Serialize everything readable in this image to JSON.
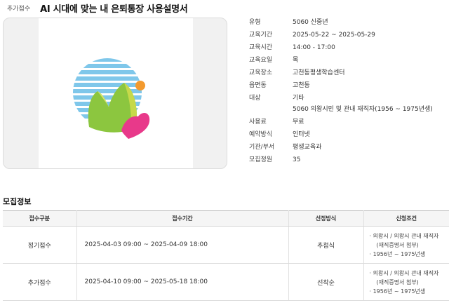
{
  "header": {
    "badge": "추가접수",
    "title": "AI 시대에 맞는 내 은퇴통장 사용설명서"
  },
  "info": [
    {
      "label": "유형",
      "value": "5060 신중년"
    },
    {
      "label": "교육기간",
      "value": "2025-05-22 ~ 2025-05-29"
    },
    {
      "label": "교육시간",
      "value": "14:00 - 17:00"
    },
    {
      "label": "교육요일",
      "value": "목"
    },
    {
      "label": "교육장소",
      "value": "고천동평생학습센터"
    },
    {
      "label": "읍면동",
      "value": "고천동"
    },
    {
      "label": "대상",
      "value": "기타",
      "sub": "5060 의왕시민 및 관내 재직자(1956 ~ 1975년생)"
    },
    {
      "label": "사용료",
      "value": "무료"
    },
    {
      "label": "예약방식",
      "value": "인터넷"
    },
    {
      "label": "기관/부서",
      "value": "평생교육과"
    },
    {
      "label": "모집정원",
      "value": "35"
    }
  ],
  "recruit": {
    "title": "모집정보",
    "columns": [
      "접수구분",
      "접수기간",
      "선정방식",
      "신청조건"
    ],
    "rows": [
      {
        "type": "정기접수",
        "period": "2025-04-03 09:00 ~ 2025-04-09 18:00",
        "method": "추첨식",
        "cond1": "의왕시 / 의왕시 관내 재직자",
        "cond1_sub": "(재직증명서 첨부)",
        "cond2": "1956년 ~ 1975년생"
      },
      {
        "type": "추가접수",
        "period": "2025-04-10 09:00 ~ 2025-05-18 18:00",
        "method": "선착순",
        "cond1": "의왕시 / 의왕시 관내 재직자",
        "cond1_sub": "(재직증명서 첨부)",
        "cond2": "1956년 ~ 1975년생"
      }
    ]
  },
  "colors": {
    "stripe": "#7fc7ea",
    "mountain_green": "#8cc63f",
    "mountain_light": "#c6d94a",
    "heart": "#e8398a",
    "sun": "#f39a2e"
  },
  "icons": {
    "logo": "uiwang-city-emblem"
  }
}
